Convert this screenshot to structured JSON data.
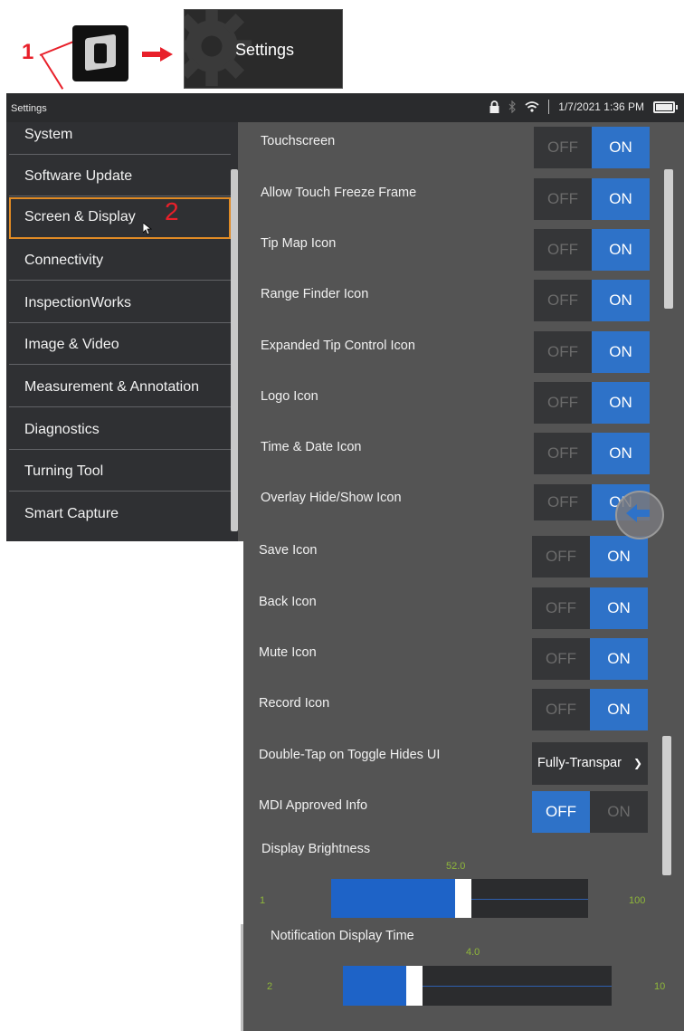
{
  "callouts": {
    "step1": "1",
    "step2": "2"
  },
  "settings_tile": {
    "label": "Settings"
  },
  "statusbar": {
    "title": "Settings",
    "datetime": "1/7/2021 1:36 PM"
  },
  "sidebar": {
    "items": [
      {
        "label": "System"
      },
      {
        "label": "Software Update"
      },
      {
        "label": "Screen & Display",
        "active": true
      },
      {
        "label": "Connectivity"
      },
      {
        "label": "InspectionWorks"
      },
      {
        "label": "Image & Video"
      },
      {
        "label": "Measurement & Annotation"
      },
      {
        "label": "Diagnostics"
      },
      {
        "label": "Turning Tool"
      },
      {
        "label": "Smart Capture"
      }
    ]
  },
  "toggle_text": {
    "off": "OFF",
    "on": "ON"
  },
  "settings": [
    {
      "label": "Touchscreen",
      "state": "ON"
    },
    {
      "label": "Allow Touch Freeze Frame",
      "state": "ON"
    },
    {
      "label": "Tip Map Icon",
      "state": "ON"
    },
    {
      "label": "Range Finder Icon",
      "state": "ON"
    },
    {
      "label": "Expanded Tip Control Icon",
      "state": "ON"
    },
    {
      "label": "Logo Icon",
      "state": "ON"
    },
    {
      "label": "Time & Date Icon",
      "state": "ON"
    },
    {
      "label": "Overlay Hide/Show Icon",
      "state": "ON"
    },
    {
      "label": "Save Icon",
      "state": "ON"
    },
    {
      "label": "Back Icon",
      "state": "ON"
    },
    {
      "label": "Mute Icon",
      "state": "ON"
    },
    {
      "label": "Record Icon",
      "state": "ON"
    }
  ],
  "double_tap": {
    "label": "Double-Tap on Toggle Hides UI",
    "value": "Fully-Transpar"
  },
  "mdi": {
    "label": "MDI Approved Info",
    "state": "OFF"
  },
  "brightness": {
    "title": "Display Brightness",
    "value": "52.0",
    "min": "1",
    "max": "100",
    "level": 52
  },
  "notification": {
    "title": "Notification Display Time",
    "value": "4.0",
    "min": "2",
    "max": "10",
    "level": 4
  },
  "colors": {
    "accent": "#2e72c8",
    "active_outline": "#e18b25",
    "callout": "#e8202a",
    "slider_text": "#8fb73a"
  }
}
